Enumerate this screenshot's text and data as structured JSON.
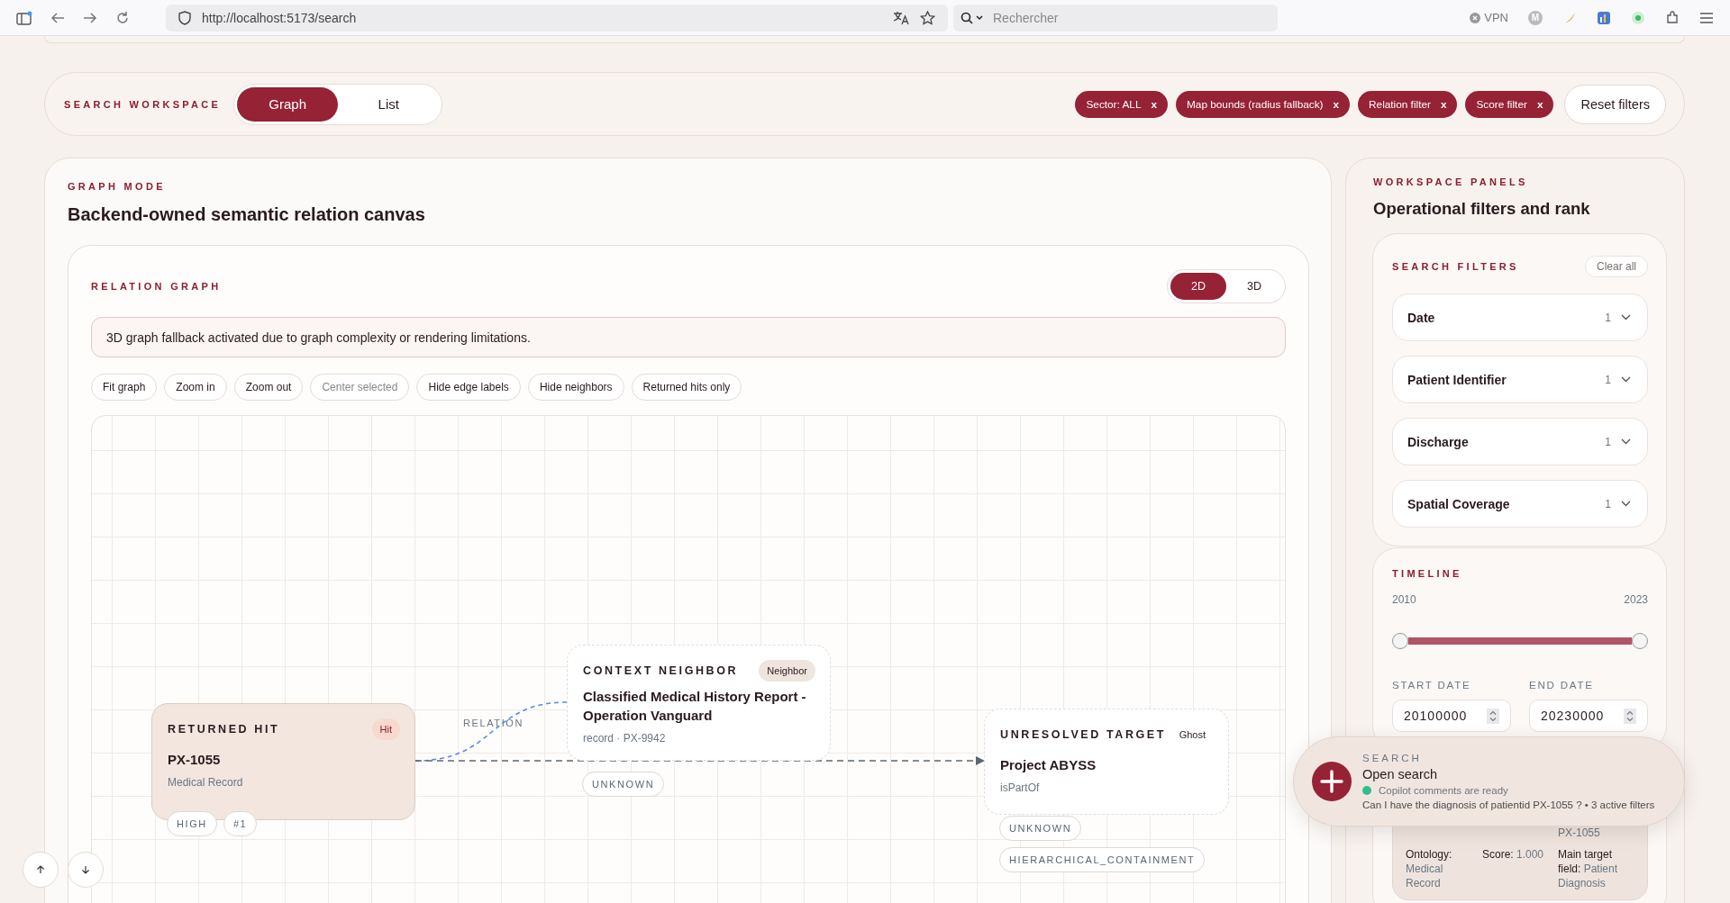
{
  "browser": {
    "url": "http://localhost:5173/search",
    "search_placeholder": "Rechercher",
    "vpn_label": "VPN",
    "profile_initial": "M"
  },
  "header": {
    "label": "SEARCH WORKSPACE",
    "view_tabs": [
      {
        "label": "Graph",
        "selected": true
      },
      {
        "label": "List",
        "selected": false
      }
    ],
    "filter_chips": [
      {
        "label": "Sector: ALL",
        "remove": "x"
      },
      {
        "label": "Map bounds (radius fallback)",
        "remove": "x"
      },
      {
        "label": "Relation filter",
        "remove": "x"
      },
      {
        "label": "Score filter",
        "remove": "x"
      }
    ],
    "reset": "Reset filters"
  },
  "graph_mode": {
    "label": "GRAPH MODE",
    "title": "Backend-owned semantic relation canvas",
    "relation_graph": {
      "label": "RELATION GRAPH",
      "dimension_tabs": [
        {
          "label": "2D",
          "selected": true
        },
        {
          "label": "3D",
          "selected": false
        }
      ],
      "alert": "3D graph fallback activated due to graph complexity or rendering limitations.",
      "tools": [
        {
          "label": "Fit graph",
          "disabled": false
        },
        {
          "label": "Zoom in",
          "disabled": false
        },
        {
          "label": "Zoom out",
          "disabled": false
        },
        {
          "label": "Center selected",
          "disabled": true
        },
        {
          "label": "Hide edge labels",
          "disabled": false
        },
        {
          "label": "Hide neighbors",
          "disabled": false
        },
        {
          "label": "Returned hits only",
          "disabled": false
        }
      ],
      "nodes": [
        {
          "kind": "hit",
          "eyebrow": "RETURNED HIT",
          "badge": "Hit",
          "title": "PX-1055",
          "subtitle": "Medical Record",
          "chips": [
            "HIGH",
            "#1"
          ]
        },
        {
          "kind": "neighbor",
          "eyebrow": "CONTEXT NEIGHBOR",
          "badge": "Neighbor",
          "title": "Classified Medical History Report - Operation Vanguard",
          "subtitle": "record · PX-9942",
          "chips": [
            "UNKNOWN"
          ]
        },
        {
          "kind": "ghost",
          "eyebrow": "UNRESOLVED TARGET",
          "badge": "Ghost",
          "title": "Project ABYSS",
          "subtitle": "isPartOf",
          "chips": [
            "UNKNOWN",
            "HIERARCHICAL_CONTAINMENT"
          ]
        }
      ],
      "edges": [
        {
          "kind": "relation",
          "label": "RELATION"
        },
        {
          "kind": "target"
        }
      ]
    }
  },
  "panels": {
    "label": "WORKSPACE PANELS",
    "title": "Operational filters and rank",
    "search_filters": {
      "label": "SEARCH FILTERS",
      "clear": "Clear all",
      "items": [
        {
          "label": "Date",
          "count": "1",
          "expanded": false
        },
        {
          "label": "Patient Identifier",
          "count": "1",
          "expanded": false
        },
        {
          "label": "Discharge",
          "count": "1",
          "expanded": false
        },
        {
          "label": "Spatial Coverage",
          "count": "1",
          "expanded": false
        }
      ]
    },
    "timeline": {
      "label": "TIMELINE",
      "start_year": "2010",
      "end_year": "2023",
      "thumbs": [
        {
          "level": 0
        },
        {
          "level": 1
        }
      ],
      "start_label": "START DATE",
      "end_label": "END DATE",
      "start_value": "20100000",
      "end_value": "20230000"
    },
    "result": {
      "id": "PX-1055",
      "fields": [
        {
          "label": "Ontology:",
          "value": "Medical Record"
        },
        {
          "label": "Score:",
          "value": "1.000"
        },
        {
          "label": "Main target field:",
          "value": "Patient Diagnosis"
        }
      ]
    }
  },
  "popup": {
    "label": "SEARCH",
    "title": "Open search",
    "status": {
      "text": "Copilot comments are ready",
      "ready": true
    },
    "query": "Can I have the diagnosis of patientid PX-1055 ? • 3 active filters"
  }
}
